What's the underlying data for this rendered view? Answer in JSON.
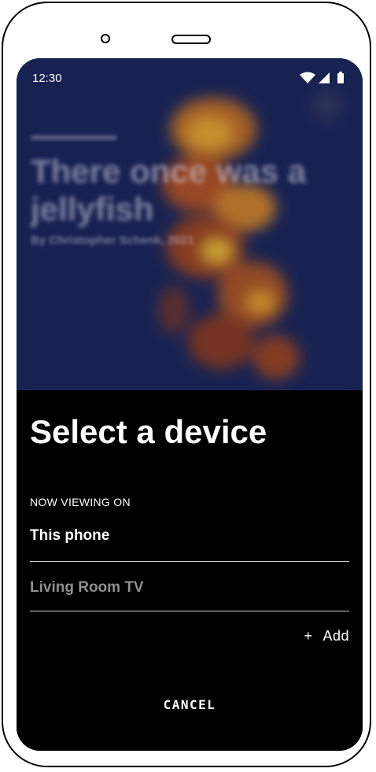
{
  "status_bar": {
    "time": "12:30",
    "icons": [
      "wifi-icon",
      "cell-signal-icon",
      "battery-icon"
    ]
  },
  "background_story": {
    "title": "There once was a jellyfish",
    "byline": "By Christopher Schenk, 2021"
  },
  "sheet": {
    "title": "Select a device",
    "section_label": "NOW VIEWING ON",
    "devices": [
      {
        "label": "This phone",
        "state": "current"
      },
      {
        "label": "Living Room TV",
        "state": "available"
      }
    ],
    "add_plus": "+",
    "add_label": "Add",
    "cancel_label": "CANCEL"
  },
  "colors": {
    "sheet_background": "#000000",
    "text_primary": "#ffffff",
    "text_secondary": "#8f8f8f",
    "divider": "#cfcfcf",
    "backdrop_blue": "#1d2a63"
  }
}
